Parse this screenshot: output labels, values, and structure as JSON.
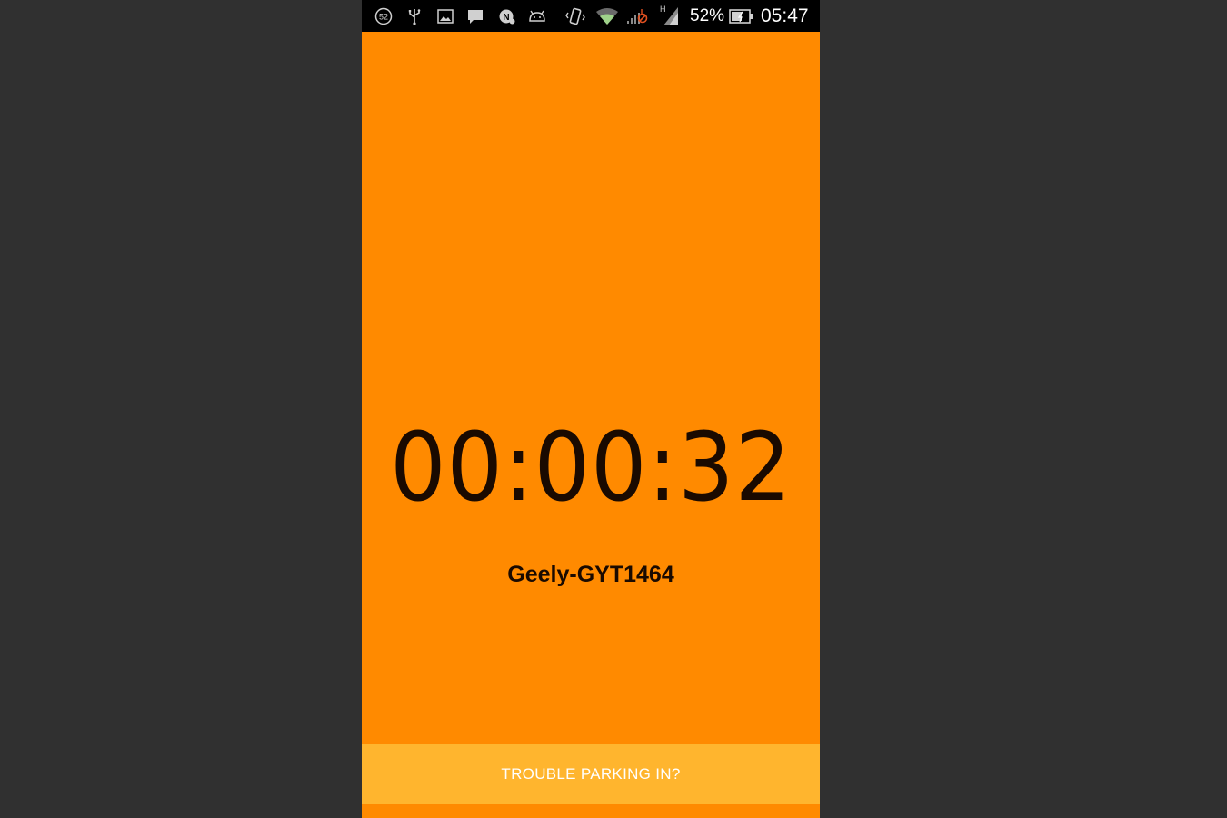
{
  "status_bar": {
    "notification_badge": "52",
    "battery_percent": "52%",
    "clock": "05:47",
    "network_type": "H",
    "icons": [
      "notification-count-icon",
      "usb-icon",
      "gallery-icon",
      "message-icon",
      "n-app-icon",
      "android-icon",
      "vibrate-icon",
      "wifi-icon",
      "no-signal-icon",
      "cell-signal-icon",
      "battery-icon"
    ]
  },
  "timer": {
    "elapsed": "00:00:32"
  },
  "vehicle": {
    "label": "Geely-GYT1464"
  },
  "actions": {
    "trouble_label": "TROUBLE PARKING IN?"
  },
  "colors": {
    "background": "#ff8a00",
    "button": "#ffb52e",
    "outer": "#303030"
  }
}
